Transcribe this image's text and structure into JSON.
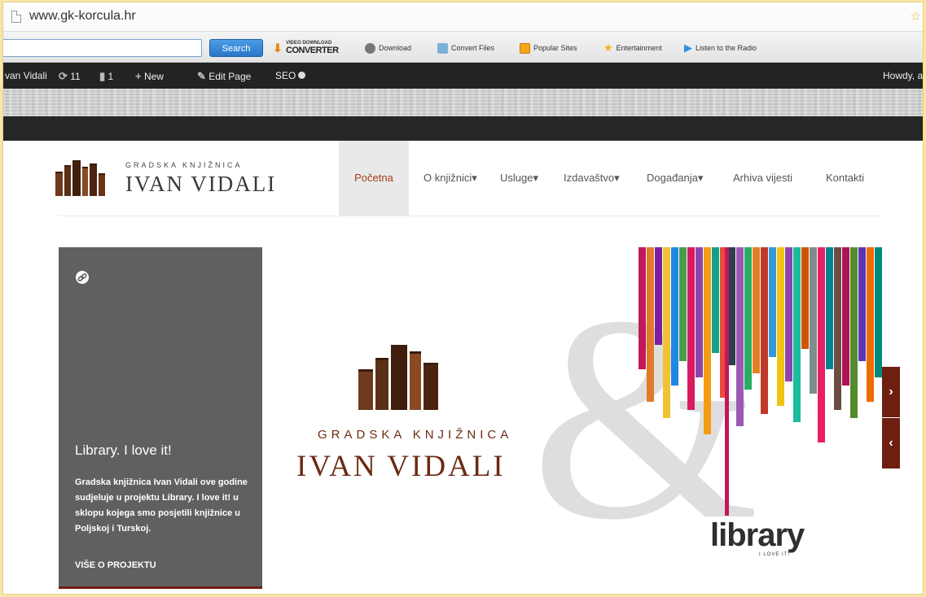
{
  "browser": {
    "url": "www.gk-korcula.hr"
  },
  "toolbar": {
    "search_button": "Search",
    "video_converter_small": "VIDEO DOWNLOAD",
    "video_converter_big": "CONVERTER",
    "items": [
      {
        "label": "Download",
        "icon": "download-icon",
        "color": "#777777"
      },
      {
        "label": "Convert Files",
        "icon": "convert-files-icon",
        "color": "#7bb0d8"
      },
      {
        "label": "Popular Sites",
        "icon": "popular-sites-icon",
        "color": "#f3a51c"
      },
      {
        "label": "Entertainment",
        "icon": "star-icon",
        "color": "#f2b619"
      },
      {
        "label": "Listen to the Radio",
        "icon": "radio-icon",
        "color": "#2d8fe3"
      }
    ]
  },
  "adminbar": {
    "site_name": "van Vidali",
    "updates_count": "11",
    "comments_count": "1",
    "new_label": "New",
    "edit_label": "Edit Page",
    "seo_label": "SEO",
    "howdy": "Howdy, a"
  },
  "site": {
    "logo_sub": "GRADSKA KNJIŽNICA",
    "logo_name": "IVAN VIDALI",
    "nav": [
      "Početna",
      "O knjižnici",
      "Usluge",
      "Izdavaštvo",
      "Događanja",
      "Arhiva vijesti",
      "Kontakti"
    ],
    "nav_active": "Početna",
    "brand_color": "#6b2a12"
  },
  "card": {
    "title": "Library. I love it!",
    "text": "Gradska knjižnica Ivan Vidali ove godine sudjeluje u projektu Library. I love it! u sklopu kojega smo posjetili knjižnice u Poljskoj i Turskoj.",
    "more": "VIŠE O PROJEKTU"
  },
  "hero": {
    "sub": "GRADSKA KNJIŽNICA",
    "name": "IVAN VIDALI",
    "ampersand": "&",
    "library": "library",
    "library_sub": "I LOVE IT!"
  },
  "slider": {
    "next_icon": "chevron-right-icon",
    "prev_icon": "chevron-left-icon"
  }
}
